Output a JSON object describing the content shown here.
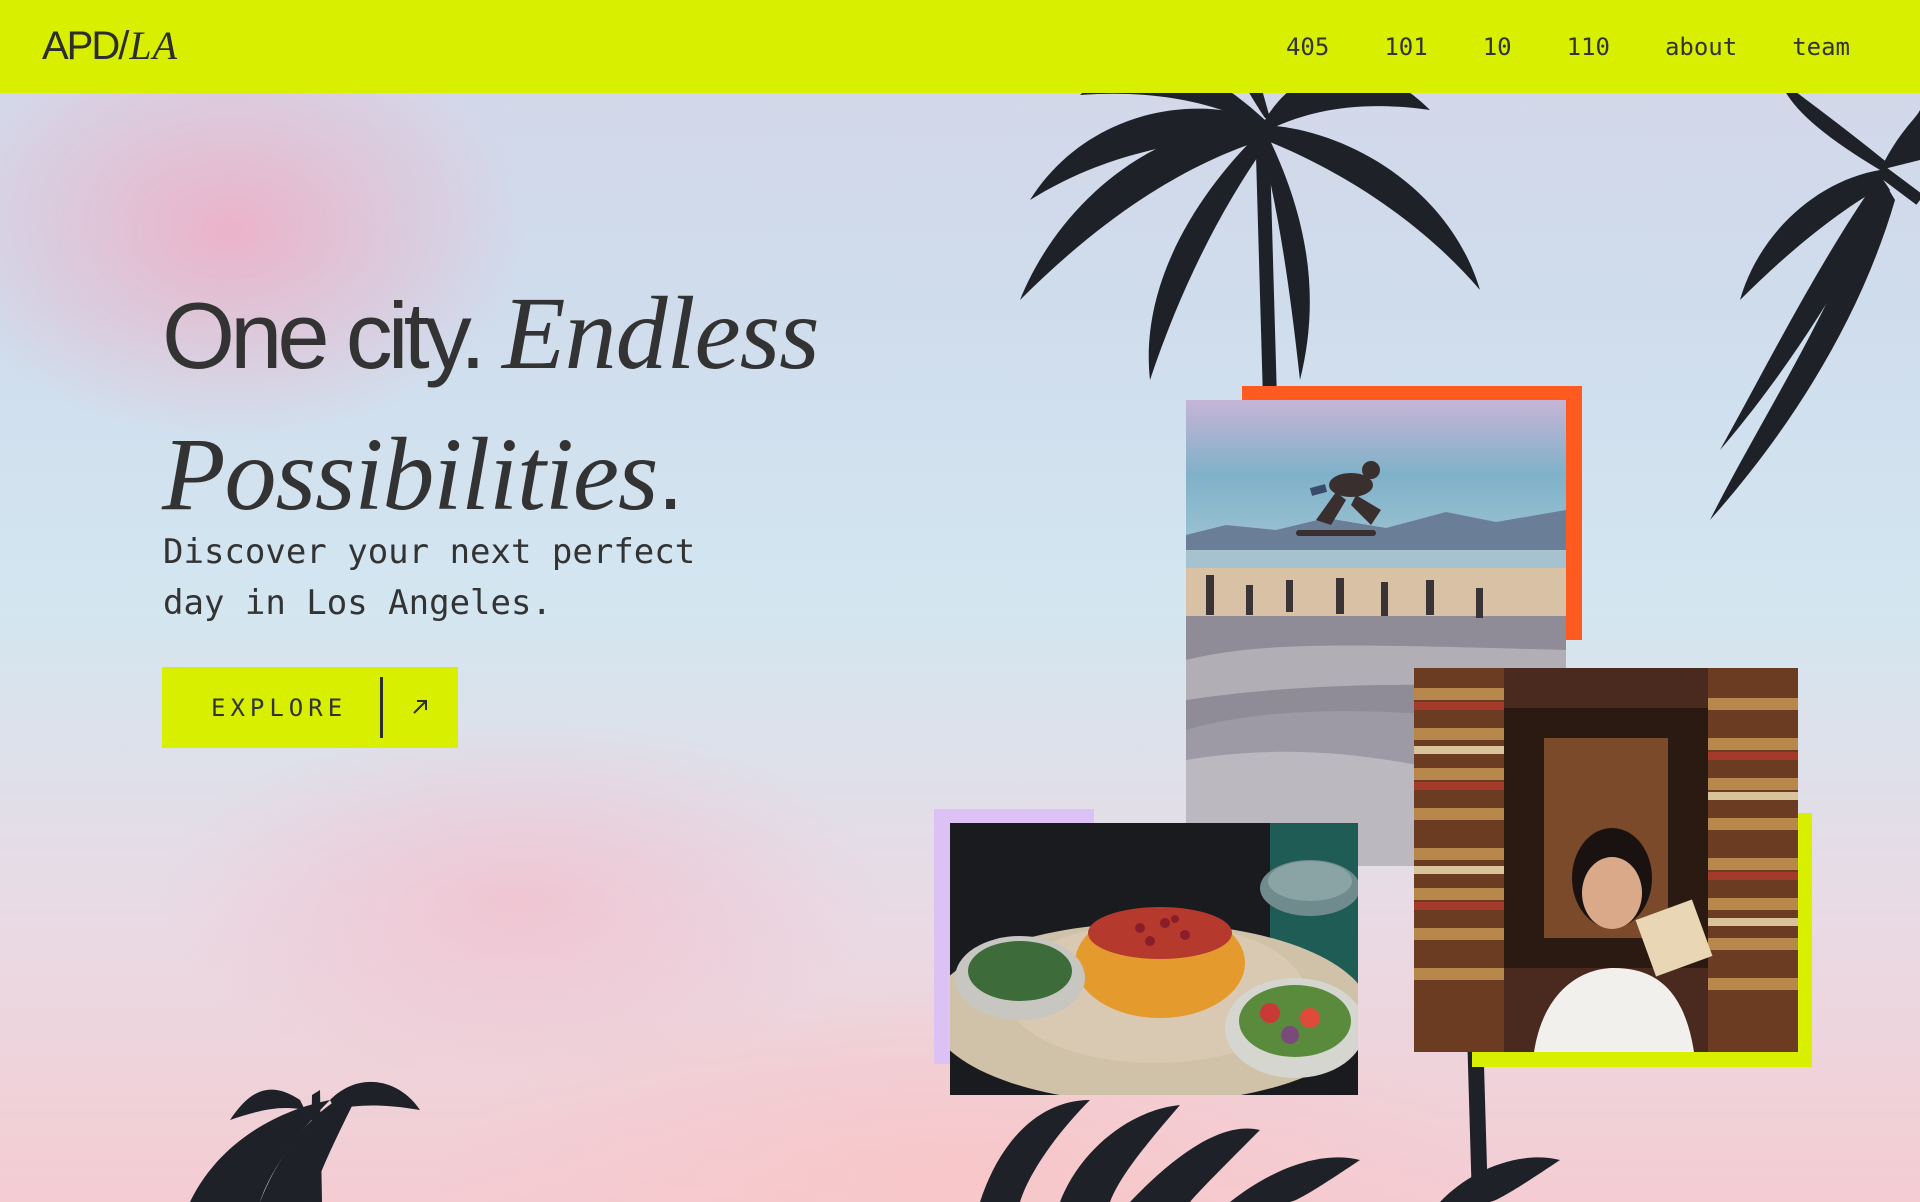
{
  "header": {
    "logo_main": "APD/",
    "logo_accent": "LA",
    "nav": [
      {
        "label": "405"
      },
      {
        "label": "101"
      },
      {
        "label": "10"
      },
      {
        "label": "110"
      },
      {
        "label": "about"
      },
      {
        "label": "team"
      }
    ]
  },
  "hero": {
    "headline_plain": "One city. ",
    "headline_italic": "Endless Possibilities",
    "headline_period": ".",
    "subtitle": "Discover your next perfect day in Los Angeles.",
    "cta_label": "EXPLORE",
    "cta_icon": "arrow-up-right-icon"
  },
  "collage": {
    "photos": [
      {
        "subject": "skateboarder",
        "accent": "#ff5a1f"
      },
      {
        "subject": "persian-rice-dish",
        "accent": "#dcc1f5"
      },
      {
        "subject": "bookstore-reader",
        "accent": "#d8ef00"
      }
    ]
  },
  "colors": {
    "brand_lime": "#d8ef00",
    "accent_orange": "#ff5a1f",
    "accent_lavender": "#dcc1f5",
    "text_dark": "#333333"
  }
}
